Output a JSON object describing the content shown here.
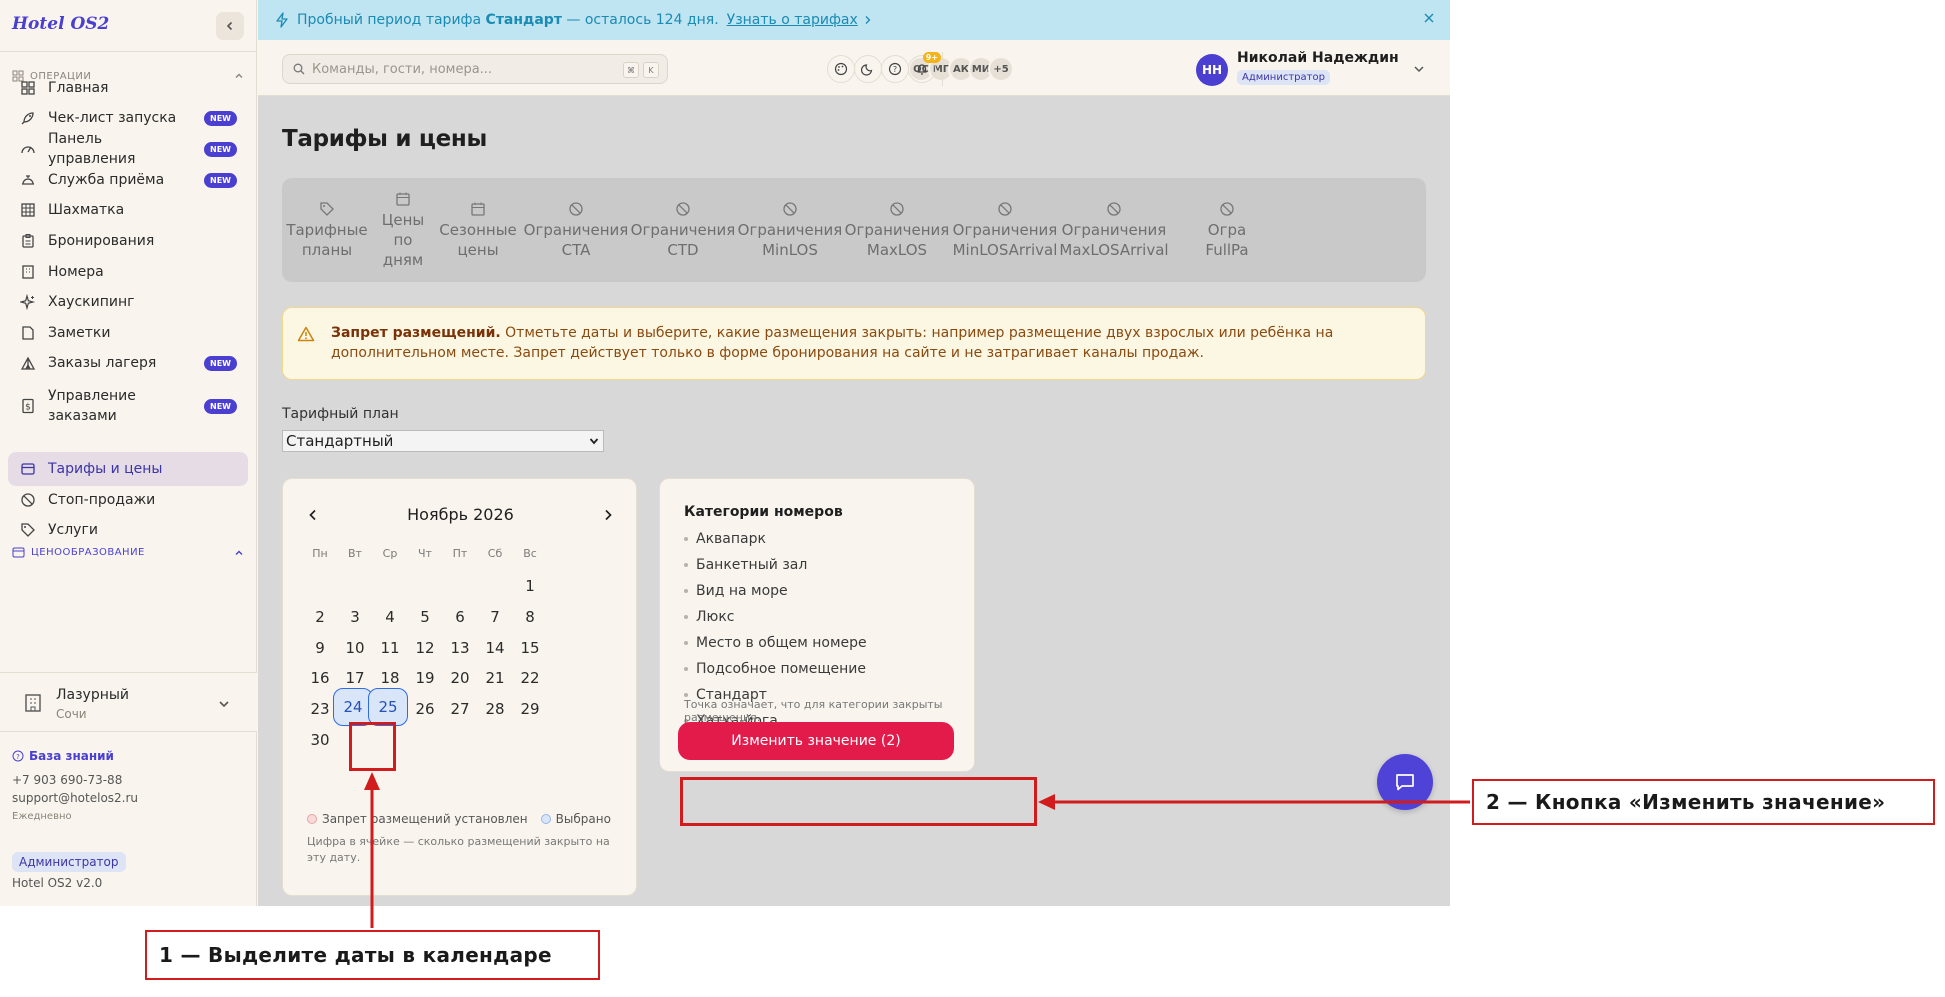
{
  "app": {
    "brand": "Hotel OS2"
  },
  "sidebar": {
    "section_ops": "Операции",
    "section_pricing": "Ценообразование",
    "items": [
      {
        "label": "Главная",
        "icon": "grid-icon",
        "new": false
      },
      {
        "label": "Чек-лист запуска",
        "icon": "rocket-icon",
        "new": true
      },
      {
        "label": "Панель управления",
        "icon": "gauge-icon",
        "new": true
      },
      {
        "label": "Служба приёма",
        "icon": "bell-desk-icon",
        "new": true
      },
      {
        "label": "Шахматка",
        "icon": "table-icon",
        "new": false
      },
      {
        "label": "Бронирования",
        "icon": "clipboard-icon",
        "new": false
      },
      {
        "label": "Номера",
        "icon": "building-icon",
        "new": false
      },
      {
        "label": "Хаускипинг",
        "icon": "sparkle-icon",
        "new": false
      },
      {
        "label": "Заметки",
        "icon": "note-icon",
        "new": false
      },
      {
        "label": "Заказы лагеря",
        "icon": "tent-icon",
        "new": true
      },
      {
        "label": "Управление заказами",
        "icon": "dollar-doc-icon",
        "new": true
      }
    ],
    "pricing_items": [
      {
        "label": "Тарифы и цены",
        "icon": "card-icon",
        "active": true
      },
      {
        "label": "Стоп-продажи",
        "icon": "ban-icon",
        "active": false
      },
      {
        "label": "Услуги",
        "icon": "tag-icon",
        "active": false
      }
    ],
    "new_badge": "NEW",
    "hotel": {
      "name": "Лазурный",
      "city": "Сочи"
    },
    "footer": {
      "kb": "База знаний",
      "phone": "+7 903 690-73-88",
      "email": "support@hotelos2.ru",
      "hours": "Ежедневно",
      "role": "Администратор",
      "version": "Hotel OS2 v2.0"
    }
  },
  "banner": {
    "prefix": "Пробный период тарифа",
    "plan": "Стандарт",
    "suffix": "— осталось 124 дня.",
    "link": "Узнать о тарифах"
  },
  "topbar": {
    "search_placeholder": "Команды, гости, номера...",
    "kbd1": "⌘",
    "kbd2": "K",
    "avatars": [
      "ОС",
      "МГ",
      "АК",
      "МИ",
      "+5"
    ],
    "notif_count": "9+",
    "user": {
      "initials": "НН",
      "name": "Николай Надеждин",
      "role": "Администратор"
    }
  },
  "main": {
    "title": "Тарифы и цены",
    "tabs": [
      [
        "Тарифные",
        "планы"
      ],
      [
        "Цены",
        "по",
        "дням"
      ],
      [
        "Сезонные",
        "цены"
      ],
      [
        "Ограничения",
        "CTA"
      ],
      [
        "Ограничения",
        "CTD"
      ],
      [
        "Ограничения",
        "MinLOS"
      ],
      [
        "Ограничения",
        "MaxLOS"
      ],
      [
        "Ограничения",
        "MinLOSArrival"
      ],
      [
        "Ограничения",
        "MaxLOSArrival"
      ],
      [
        "Огра",
        "FullPa"
      ]
    ],
    "warning": {
      "bold": "Запрет размещений.",
      "text": "Отметьте даты и выберите, какие размещения закрыть: например размещение двух взрослых или ребёнка на дополнительном месте. Запрет действует только в форме бронирования на сайте и не затрагивает каналы продаж."
    },
    "plan_label": "Тарифный план",
    "plan_value": "Стандартный",
    "calendar": {
      "month": "Ноябрь 2026",
      "weekdays": [
        "Пн",
        "Вт",
        "Ср",
        "Чт",
        "Пт",
        "Сб",
        "Вс"
      ],
      "first_weekday_index": 6,
      "days_in_month": 30,
      "selected": [
        24,
        25
      ],
      "legend_blocked": "Запрет размещений установлен",
      "legend_selected": "Выбрано",
      "note": "Цифра в ячейке — сколько размещений закрыто на эту дату."
    },
    "categories": {
      "title": "Категории номеров",
      "items": [
        "Аквапарк",
        "Банкетный зал",
        "Вид на море",
        "Люкс",
        "Место в общем номере",
        "Подсобное помещение",
        "Стандарт",
        "Хатха-йога"
      ],
      "note": "Точка означает, что для категории закрыты размещения.",
      "button": "Изменить значение (2)"
    }
  },
  "annotations": {
    "step1": "1 — Выделите даты в календаре",
    "step2": "2 — Кнопка «Изменить значение»"
  },
  "colors": {
    "accent": "#4a3fd0",
    "danger": "#e21b4a",
    "annotation": "#d01c1c",
    "banner_bg": "#bfe4f2"
  }
}
